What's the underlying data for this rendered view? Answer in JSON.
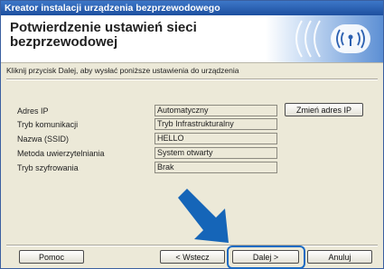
{
  "window": {
    "title": "Kreator instalacji urządzenia bezprzewodowego"
  },
  "header": {
    "title": "Potwierdzenie ustawień sieci bezprzewodowej",
    "icon": "wifi-signal-icon"
  },
  "instruction": "Kliknij przycisk Dalej, aby wysłać poniższe ustawienia do urządzenia",
  "settings": [
    {
      "label": "Adres IP",
      "value": "Automatyczny"
    },
    {
      "label": "Tryb komunikacji",
      "value": "Tryb Infrastrukturalny"
    },
    {
      "label": "Nazwa (SSID)",
      "value": "HELLO"
    },
    {
      "label": "Metoda uwierzytelniania",
      "value": "System otwarty"
    },
    {
      "label": "Tryb szyfrowania",
      "value": "Brak"
    }
  ],
  "buttons": {
    "change_ip": "Zmień adres IP",
    "help": "Pomoc",
    "back": "< Wstecz",
    "next": "Dalej >",
    "cancel": "Anuluj"
  },
  "colors": {
    "accent": "#1b6bc3",
    "arrow": "#1565b8",
    "title_bar": "#2a5fb0"
  }
}
